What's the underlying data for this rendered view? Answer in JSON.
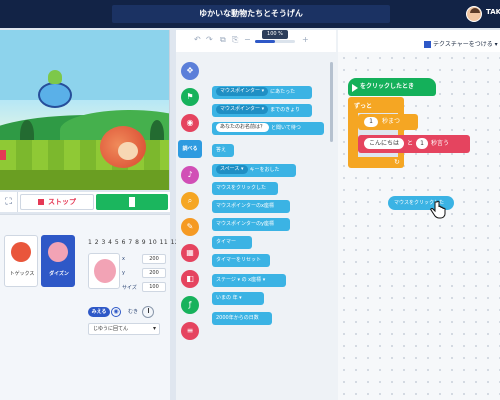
{
  "app": {
    "title": "ゆかいな動物たちとそうげん",
    "user": "TAKA"
  },
  "stage_controls": {
    "fullscreen_glyph": "⛶",
    "stop_label": "ストップ"
  },
  "sprites": [
    {
      "label": "トゲックス",
      "selected": false
    },
    {
      "label": "ダイズン",
      "selected": true
    }
  ],
  "sprite_props": {
    "costume_numbers": "1 2 3 4 5 6 7 8 9 10 11 12",
    "x_label": "x",
    "x_value": "200",
    "y_label": "y",
    "y_value": "200",
    "size_label": "サイズ",
    "size_value": "100",
    "visible_label": "みえる",
    "visible_glyph": "◉",
    "direction_label": "むき",
    "rotation_style": "じゆうに回てん"
  },
  "palette": {
    "zoom_level": "100 %",
    "categories": [
      {
        "icon": "move-icon",
        "glyph": "✥",
        "color": "#5b7fd9"
      },
      {
        "icon": "flag-icon",
        "glyph": "⚑",
        "color": "#17b25c"
      },
      {
        "icon": "looks-icon",
        "glyph": "◉",
        "color": "#e5445f"
      },
      {
        "icon": "sensing-icon",
        "glyph": "調べる",
        "color": "#2e9be0",
        "selected": true
      },
      {
        "icon": "music-icon",
        "glyph": "♪",
        "color": "#d14fb6"
      },
      {
        "icon": "search-icon",
        "glyph": "⌕",
        "color": "#f5a623"
      },
      {
        "icon": "pen-icon",
        "glyph": "✎",
        "color": "#f59a23"
      },
      {
        "icon": "calc-icon",
        "glyph": "▦",
        "color": "#e5445f"
      },
      {
        "icon": "variable-icon",
        "glyph": "◧",
        "color": "#e5445f"
      },
      {
        "icon": "function-icon",
        "glyph": "ƒ",
        "color": "#17b25c"
      },
      {
        "icon": "list-icon",
        "glyph": "≡",
        "color": "#e5445f"
      }
    ],
    "blocks": [
      {
        "pill": "マウスポインター ▾",
        "text": "にあたった"
      },
      {
        "pill": "マウスポインター ▾",
        "text": "までのきょり"
      },
      {
        "pill": "あなたのお名前は？",
        "text": "と聞いて待つ",
        "white": true
      },
      {
        "text": "答え"
      },
      {
        "pill": "スペース ▾",
        "text": "キーをおした"
      },
      {
        "text": "マウスをクリックした"
      },
      {
        "text": "マウスポインターのx座標"
      },
      {
        "text": "マウスポインターのy座標"
      },
      {
        "text": "タイマー"
      },
      {
        "text": "タイマーをリセット"
      },
      {
        "text": "ステージ ▾ の x座標 ▾"
      },
      {
        "text": "いまの 年 ▾"
      },
      {
        "text": "2000年からの日数"
      }
    ]
  },
  "workspace": {
    "extension_label": "テクスチャーをつける",
    "hat_label": "をクリックしたとき",
    "forever_label": "ずっと",
    "wait_value": "1",
    "wait_label": "秒まつ",
    "say_text": "こんにちは",
    "say_and": "と",
    "say_value": "1",
    "say_label": "秒言う",
    "loop_glyph": "↻",
    "dragging_block": "マウスをクリックした"
  }
}
